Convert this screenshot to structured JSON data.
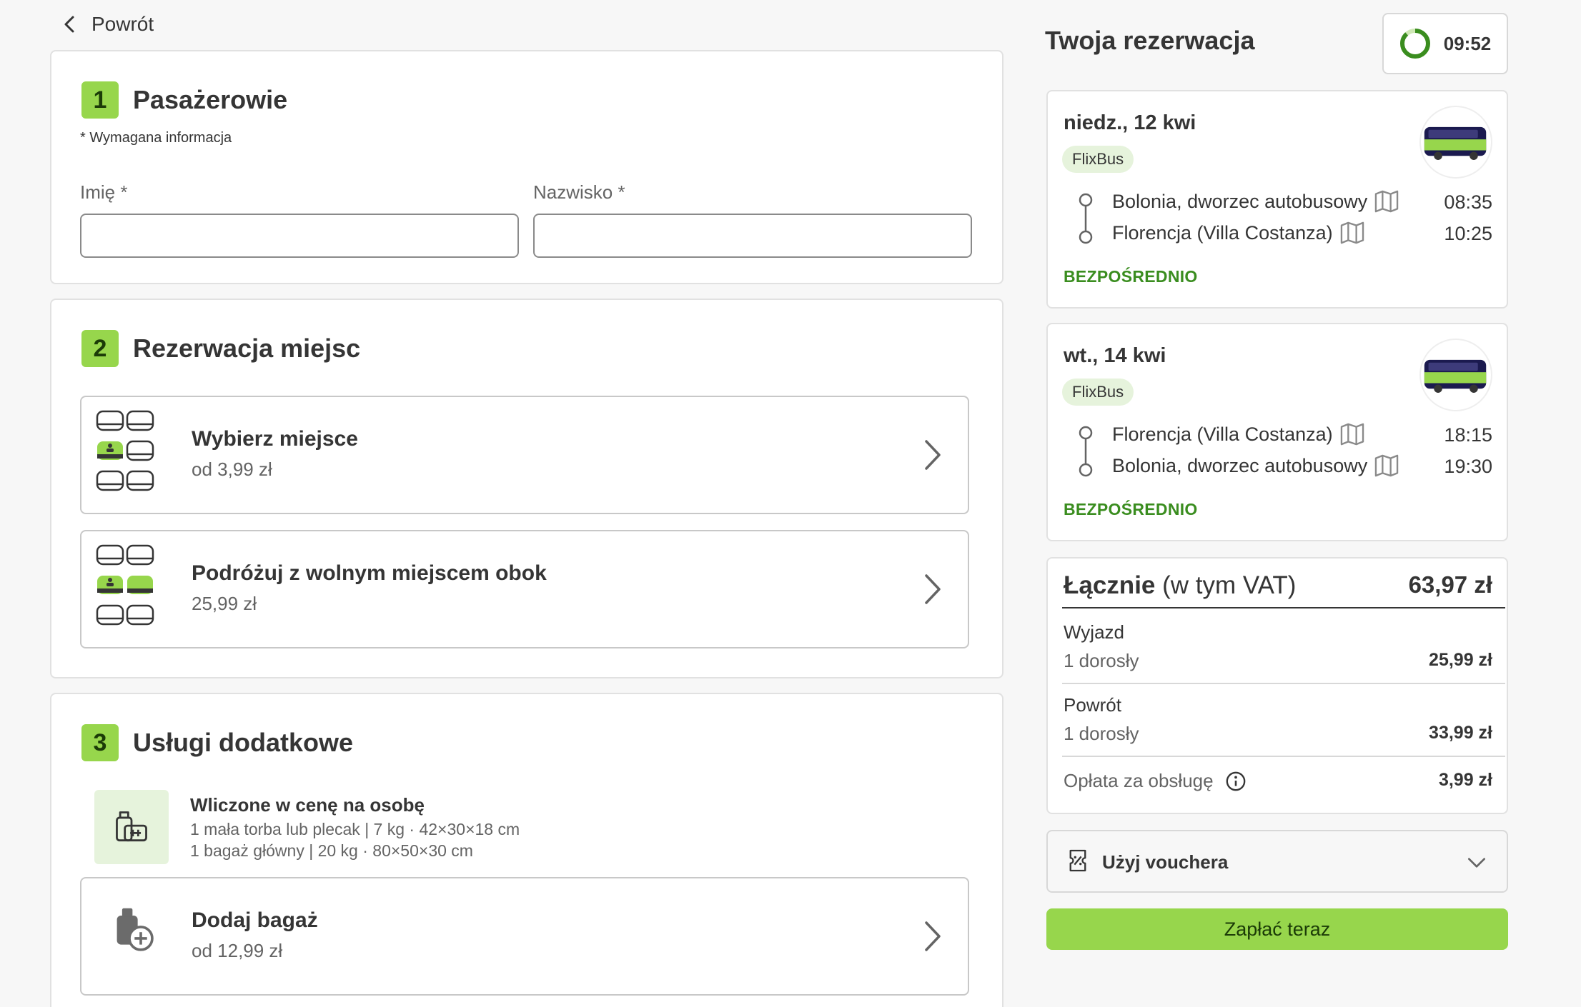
{
  "nav": {
    "back_label": "Powrót"
  },
  "passengers": {
    "step": "1",
    "title": "Pasażerowie",
    "required_note": "* Wymagana informacja",
    "first_name_label": "Imię *",
    "first_name_value": "",
    "last_name_label": "Nazwisko *",
    "last_name_value": ""
  },
  "seats": {
    "step": "2",
    "title": "Rezerwacja miejsc",
    "options": [
      {
        "title": "Wybierz miejsce",
        "price": "od 3,99 zł"
      },
      {
        "title": "Podróżuj z wolnym miejscem obok",
        "price": "25,99 zł"
      }
    ]
  },
  "extras": {
    "step": "3",
    "title": "Usługi dodatkowe",
    "included_title": "Wliczone w cenę na osobę",
    "included_lines": [
      "1 mała torba lub plecak | 7 kg · 42×30×18 cm",
      "1 bagaż główny | 20 kg · 80×50×30 cm"
    ],
    "add_bag_title": "Dodaj bagaż",
    "add_bag_price": "od 12,99 zł"
  },
  "reservation": {
    "title": "Twoja rezerwacja",
    "timer": "09:52",
    "trips": [
      {
        "date": "niedz., 12 kwi",
        "operator": "FlixBus",
        "from": "Bolonia, dworzec autobusowy",
        "from_time": "08:35",
        "to": "Florencja (Villa Costanza)",
        "to_time": "10:25",
        "type": "BEZPOŚREDNIO"
      },
      {
        "date": "wt., 14 kwi",
        "operator": "FlixBus",
        "from": "Florencja (Villa Costanza)",
        "from_time": "18:15",
        "to": "Bolonia, dworzec autobusowy",
        "to_time": "19:30",
        "type": "BEZPOŚREDNIO"
      }
    ],
    "summary": {
      "total_label_bold": "Łącznie",
      "total_label_rest": " (w tym VAT)",
      "total": "63,97 zł",
      "outbound_label": "Wyjazd",
      "outbound_sub": "1 dorosły",
      "outbound_amount": "25,99 zł",
      "return_label": "Powrót",
      "return_sub": "1 dorosły",
      "return_amount": "33,99 zł",
      "fee_label": "Opłata za obsługę",
      "fee_amount": "3,99 zł"
    },
    "voucher_label": "Użyj vouchera",
    "pay_label": "Zapłać teraz"
  },
  "colors": {
    "accent": "#97d64c",
    "accent_light": "#e6f3dc",
    "direct_green": "#3a8d1f"
  },
  "icons": [
    "chevron-left-icon",
    "seat-map-icon",
    "chevron-right-icon",
    "luggage-icon",
    "add-luggage-icon",
    "timer-ring-icon",
    "bus-icon",
    "map-icon",
    "route-icon",
    "info-icon",
    "voucher-icon",
    "chevron-down-icon"
  ]
}
